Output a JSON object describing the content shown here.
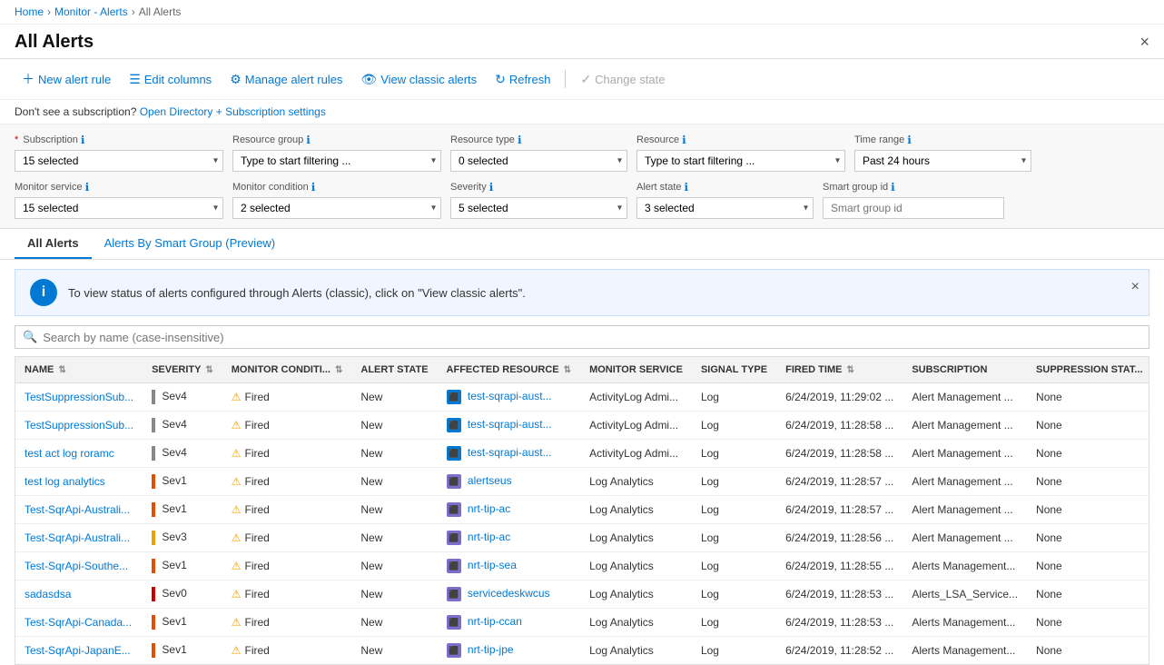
{
  "breadcrumb": {
    "items": [
      "Home",
      "Monitor - Alerts",
      "All Alerts"
    ]
  },
  "page": {
    "title": "All Alerts",
    "close_btn": "×"
  },
  "toolbar": {
    "new_alert_label": "New alert rule",
    "edit_columns_label": "Edit columns",
    "manage_alerts_label": "Manage alert rules",
    "view_classic_label": "View classic alerts",
    "refresh_label": "Refresh",
    "change_state_label": "Change state"
  },
  "notice": {
    "text": "Don't see a subscription?",
    "link_text": "Open Directory + Subscription settings"
  },
  "filters": {
    "subscription": {
      "label": "Subscription",
      "value": "15 selected",
      "required": true
    },
    "resource_group": {
      "label": "Resource group",
      "placeholder": "Type to start filtering ..."
    },
    "resource_type": {
      "label": "Resource type",
      "value": "0 selected"
    },
    "resource": {
      "label": "Resource",
      "placeholder": "Type to start filtering ..."
    },
    "time_range": {
      "label": "Time range",
      "value": "Past 24 hours"
    },
    "monitor_service": {
      "label": "Monitor service",
      "value": "15 selected"
    },
    "monitor_condition": {
      "label": "Monitor condition",
      "value": "2 selected"
    },
    "severity": {
      "label": "Severity",
      "value": "5 selected"
    },
    "alert_state": {
      "label": "Alert state",
      "value": "3 selected"
    },
    "smart_group_id": {
      "label": "Smart group id",
      "placeholder": "Smart group id"
    }
  },
  "tabs": [
    {
      "id": "all-alerts",
      "label": "All Alerts",
      "active": true
    },
    {
      "id": "smart-group",
      "label": "Alerts By Smart Group (Preview)",
      "active": false
    }
  ],
  "info_banner": {
    "text": "To view status of alerts configured through Alerts (classic), click on \"View classic alerts\"."
  },
  "search": {
    "placeholder": "Search by name (case-insensitive)"
  },
  "table": {
    "columns": [
      {
        "id": "name",
        "label": "NAME"
      },
      {
        "id": "severity",
        "label": "SEVERITY"
      },
      {
        "id": "monitor_condition",
        "label": "MONITOR CONDITI..."
      },
      {
        "id": "alert_state",
        "label": "ALERT STATE"
      },
      {
        "id": "affected_resource",
        "label": "AFFECTED RESOURCE"
      },
      {
        "id": "monitor_service",
        "label": "MONITOR SERVICE"
      },
      {
        "id": "signal_type",
        "label": "SIGNAL TYPE"
      },
      {
        "id": "fired_time",
        "label": "FIRED TIME"
      },
      {
        "id": "subscription",
        "label": "SUBSCRIPTION"
      },
      {
        "id": "suppression_stat",
        "label": "SUPPRESSION STAT..."
      }
    ],
    "rows": [
      {
        "name": "TestSuppressionSub...",
        "severity": "Sev4",
        "sev_class": "sev4",
        "monitor_condition": "Fired",
        "alert_state": "New",
        "affected_resource": "test-sqrapi-aust...",
        "resource_icon": "box",
        "monitor_service": "ActivityLog Admi...",
        "signal_type": "Log",
        "fired_time": "6/24/2019, 11:29:02 ...",
        "subscription": "Alert Management ...",
        "suppression_stat": "None"
      },
      {
        "name": "TestSuppressionSub...",
        "severity": "Sev4",
        "sev_class": "sev4",
        "monitor_condition": "Fired",
        "alert_state": "New",
        "affected_resource": "test-sqrapi-aust...",
        "resource_icon": "box",
        "monitor_service": "ActivityLog Admi...",
        "signal_type": "Log",
        "fired_time": "6/24/2019, 11:28:58 ...",
        "subscription": "Alert Management ...",
        "suppression_stat": "None"
      },
      {
        "name": "test act log roramc",
        "severity": "Sev4",
        "sev_class": "sev4",
        "monitor_condition": "Fired",
        "alert_state": "New",
        "affected_resource": "test-sqrapi-aust...",
        "resource_icon": "box",
        "monitor_service": "ActivityLog Admi...",
        "signal_type": "Log",
        "fired_time": "6/24/2019, 11:28:58 ...",
        "subscription": "Alert Management ...",
        "suppression_stat": "None"
      },
      {
        "name": "test log analytics",
        "severity": "Sev1",
        "sev_class": "sev1",
        "monitor_condition": "Fired",
        "alert_state": "New",
        "affected_resource": "alertseus",
        "resource_icon": "la",
        "monitor_service": "Log Analytics",
        "signal_type": "Log",
        "fired_time": "6/24/2019, 11:28:57 ...",
        "subscription": "Alert Management ...",
        "suppression_stat": "None"
      },
      {
        "name": "Test-SqrApi-Australi...",
        "severity": "Sev1",
        "sev_class": "sev1",
        "monitor_condition": "Fired",
        "alert_state": "New",
        "affected_resource": "nrt-tip-ac",
        "resource_icon": "la",
        "monitor_service": "Log Analytics",
        "signal_type": "Log",
        "fired_time": "6/24/2019, 11:28:57 ...",
        "subscription": "Alert Management ...",
        "suppression_stat": "None"
      },
      {
        "name": "Test-SqrApi-Australi...",
        "severity": "Sev3",
        "sev_class": "sev3",
        "monitor_condition": "Fired",
        "alert_state": "New",
        "affected_resource": "nrt-tip-ac",
        "resource_icon": "la",
        "monitor_service": "Log Analytics",
        "signal_type": "Log",
        "fired_time": "6/24/2019, 11:28:56 ...",
        "subscription": "Alert Management ...",
        "suppression_stat": "None"
      },
      {
        "name": "Test-SqrApi-Southe...",
        "severity": "Sev1",
        "sev_class": "sev1",
        "monitor_condition": "Fired",
        "alert_state": "New",
        "affected_resource": "nrt-tip-sea",
        "resource_icon": "la",
        "monitor_service": "Log Analytics",
        "signal_type": "Log",
        "fired_time": "6/24/2019, 11:28:55 ...",
        "subscription": "Alerts Management...",
        "suppression_stat": "None"
      },
      {
        "name": "sadasdsa",
        "severity": "Sev0",
        "sev_class": "sev0",
        "monitor_condition": "Fired",
        "alert_state": "New",
        "affected_resource": "servicedeskwcus",
        "resource_icon": "la",
        "monitor_service": "Log Analytics",
        "signal_type": "Log",
        "fired_time": "6/24/2019, 11:28:53 ...",
        "subscription": "Alerts_LSA_Service...",
        "suppression_stat": "None"
      },
      {
        "name": "Test-SqrApi-Canada...",
        "severity": "Sev1",
        "sev_class": "sev1",
        "monitor_condition": "Fired",
        "alert_state": "New",
        "affected_resource": "nrt-tip-ccan",
        "resource_icon": "la",
        "monitor_service": "Log Analytics",
        "signal_type": "Log",
        "fired_time": "6/24/2019, 11:28:53 ...",
        "subscription": "Alerts Management...",
        "suppression_stat": "None"
      },
      {
        "name": "Test-SqrApi-JapanE...",
        "severity": "Sev1",
        "sev_class": "sev1",
        "monitor_condition": "Fired",
        "alert_state": "New",
        "affected_resource": "nrt-tip-jpe",
        "resource_icon": "la",
        "monitor_service": "Log Analytics",
        "signal_type": "Log",
        "fired_time": "6/24/2019, 11:28:52 ...",
        "subscription": "Alerts Management...",
        "suppression_stat": "None"
      }
    ]
  }
}
